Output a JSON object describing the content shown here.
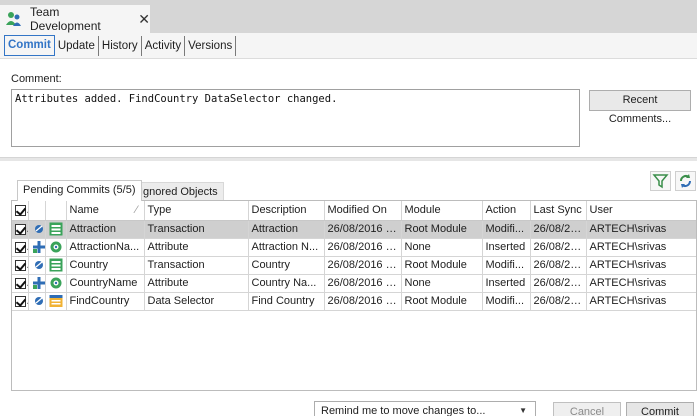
{
  "window": {
    "title": "Team Development",
    "close_glyph": "✕"
  },
  "subtabs": [
    "Commit",
    "Update",
    "History",
    "Activity",
    "Versions"
  ],
  "comment": {
    "label": "Comment:",
    "value": "Attributes added. FindCountry DataSelector changed.",
    "recent_button": "Recent Comments..."
  },
  "lower_tabs": {
    "pending": "Pending Commits (5/5)",
    "ignored": "Ignored Objects"
  },
  "toolbar_icons": {
    "filter": "filter-icon",
    "refresh": "refresh-icon"
  },
  "grid": {
    "columns": [
      "Name",
      "Type",
      "Description",
      "Modified On",
      "Module",
      "Action",
      "Last Sync",
      "User"
    ],
    "sort_indicator": "⁄",
    "rows": [
      {
        "name": "Attraction",
        "type": "Transaction",
        "description": "Attraction",
        "modified": "26/08/2016 1...",
        "module": "Root Module",
        "action": "Modifi...",
        "last_sync": "26/08/20...",
        "user": "ARTECH\\srivas",
        "status_icon": "modified-icon",
        "object_icon": "transaction-icon",
        "selected": true
      },
      {
        "name": "AttractionNa...",
        "type": "Attribute",
        "description": "Attraction N...",
        "modified": "26/08/2016 1...",
        "module": "None",
        "action": "Inserted",
        "last_sync": "26/08/20...",
        "user": "ARTECH\\srivas",
        "status_icon": "inserted-icon",
        "object_icon": "attribute-icon",
        "selected": false
      },
      {
        "name": "Country",
        "type": "Transaction",
        "description": "Country",
        "modified": "26/08/2016 1...",
        "module": "Root Module",
        "action": "Modifi...",
        "last_sync": "26/08/20...",
        "user": "ARTECH\\srivas",
        "status_icon": "modified-icon",
        "object_icon": "transaction-icon",
        "selected": false
      },
      {
        "name": "CountryName",
        "type": "Attribute",
        "description": "Country Na...",
        "modified": "26/08/2016 1...",
        "module": "None",
        "action": "Inserted",
        "last_sync": "26/08/20...",
        "user": "ARTECH\\srivas",
        "status_icon": "inserted-icon",
        "object_icon": "attribute-icon",
        "selected": false
      },
      {
        "name": "FindCountry",
        "type": "Data Selector",
        "description": "Find Country",
        "modified": "26/08/2016 1...",
        "module": "Root Module",
        "action": "Modifi...",
        "last_sync": "26/08/20...",
        "user": "ARTECH\\srivas",
        "status_icon": "modified-icon",
        "object_icon": "data-selector-icon",
        "selected": false
      }
    ]
  },
  "footer": {
    "remind": "Remind me to move changes to...",
    "cancel": "Cancel",
    "commit": "Commit"
  },
  "colors": {
    "accent": "#3375c6",
    "selection": "#cfcfcf",
    "titlebar": "#d6d6d6"
  }
}
